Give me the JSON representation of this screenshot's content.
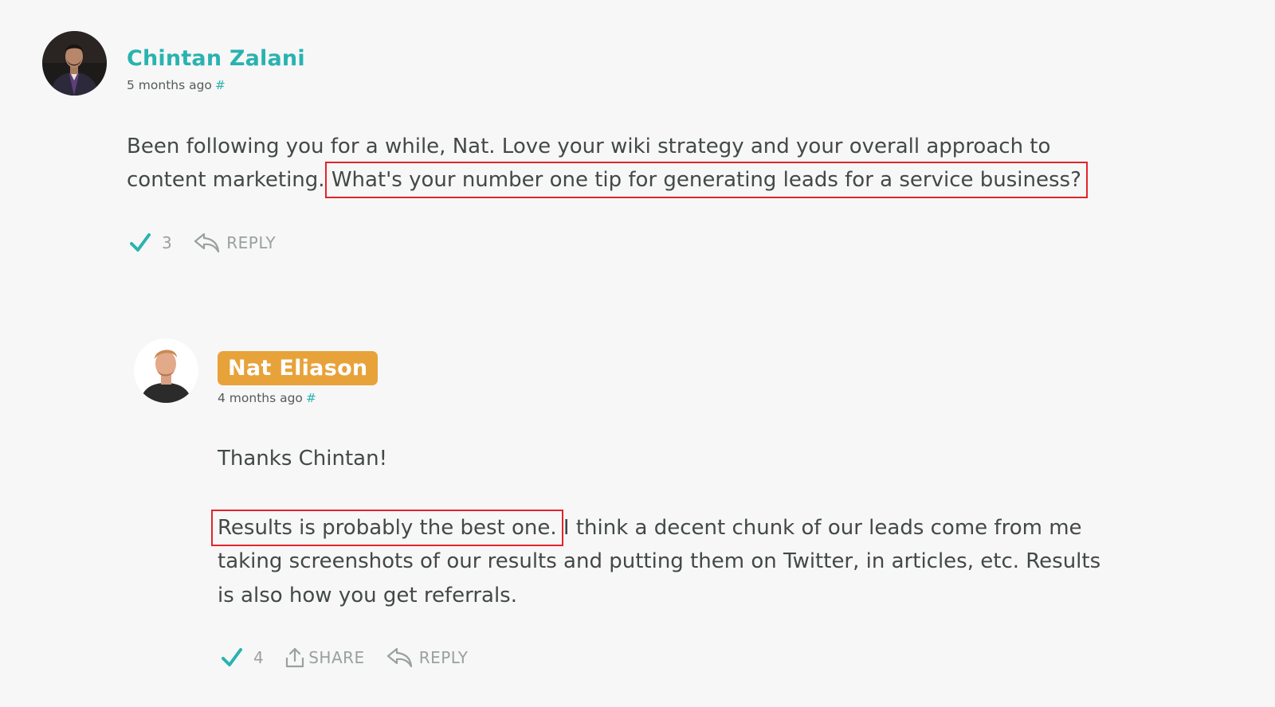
{
  "colors": {
    "accent": "#29b3b0",
    "author_badge": "#e8a23a",
    "highlight_box": "#e3242b",
    "background": "#f7f7f7"
  },
  "comment": {
    "author": "Chintan Zalani",
    "time": "5 months ago",
    "hash": "#",
    "line1": "Been following you for a while, Nat. Love your wiki strategy and your overall approach to",
    "line2_plain": "content marketing.",
    "line2_highlight": "What's your number one tip for generating leads for a service business?",
    "vote_count": "3",
    "reply_label": "REPLY",
    "icons": [
      "check-icon",
      "reply-arrow-icon"
    ]
  },
  "reply": {
    "author": "Nat Eliason",
    "time": "4 months ago",
    "hash": "#",
    "para1": "Thanks Chintan!",
    "para2_highlight": "Results is probably the best one.",
    "para2_rest": "I think a decent chunk of our leads come from me",
    "para2_line2": "taking screenshots of our results and putting them on Twitter, in articles, etc. Results",
    "para2_line3": "is also how you get referrals.",
    "vote_count": "4",
    "share_label": "SHARE",
    "reply_label": "REPLY",
    "icons": [
      "check-icon",
      "share-icon",
      "reply-arrow-icon"
    ]
  }
}
